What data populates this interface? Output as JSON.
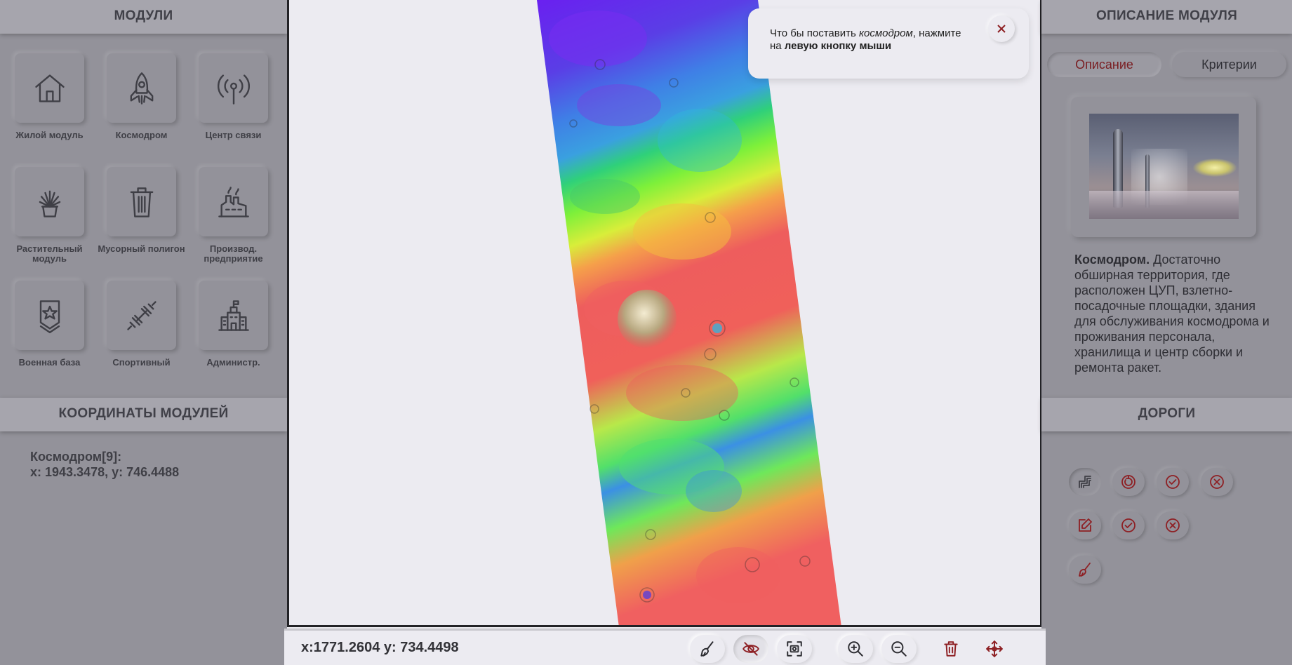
{
  "left": {
    "modules_title": "МОДУЛИ",
    "modules": [
      {
        "label": "Жилой модуль",
        "icon": "house-icon"
      },
      {
        "label": "Космодром",
        "icon": "rocket-icon"
      },
      {
        "label": "Центр связи",
        "icon": "antenna-icon"
      },
      {
        "label": "Растительный модуль",
        "icon": "plant-icon"
      },
      {
        "label": "Мусорный полигон",
        "icon": "trash-can-icon"
      },
      {
        "label": "Производ. предприятие",
        "icon": "factory-icon"
      },
      {
        "label": "Военная база",
        "icon": "military-badge-icon"
      },
      {
        "label": "Спортивный",
        "icon": "dumbbell-icon"
      },
      {
        "label": "Администр.",
        "icon": "administration-building-icon"
      }
    ],
    "coords_title": "КООРДИНАТЫ МОДУЛЕЙ",
    "coords_entry_name": "Космодром[9]:",
    "coords_entry_value": "x: 1943.3478, y: 746.4488"
  },
  "right": {
    "title": "ОПИСАНИЕ МОДУЛЯ",
    "tabs": [
      "Описание",
      "Критерии"
    ],
    "active_tab": "Описание",
    "description_title": "Космодром.",
    "description_body": " Достаточно обширная территория, где расположен ЦУП, взлетно-посадочные площадки, здания для обслуживания космодрома и проживания персонала, хранилища и центр сборки и ремонта ракет.",
    "roads_title": "ДОРОГИ",
    "road_buttons": [
      "road-build-icon",
      "rotate-icon",
      "check-icon",
      "cancel-icon",
      "edit-icon",
      "check-icon",
      "cancel-icon",
      "brush-icon"
    ]
  },
  "tooltip": {
    "text_before": "Что бы поставить ",
    "text_italic": "космодром",
    "text_middle": ", нажмите на ",
    "text_bold": "левую кнопку мыши"
  },
  "bottom": {
    "cursor_coords": "x:1771.2604 y: 734.4498",
    "tools": [
      "brush-icon",
      "hide-icon",
      "screenshot-icon",
      "zoom-in-icon",
      "zoom-out-icon",
      "delete-icon",
      "move-icon"
    ]
  },
  "colors": {
    "accent": "#8e2024",
    "panel": "#93929a",
    "header": "#a6a5ad",
    "map_bg": "#ecebf1"
  }
}
